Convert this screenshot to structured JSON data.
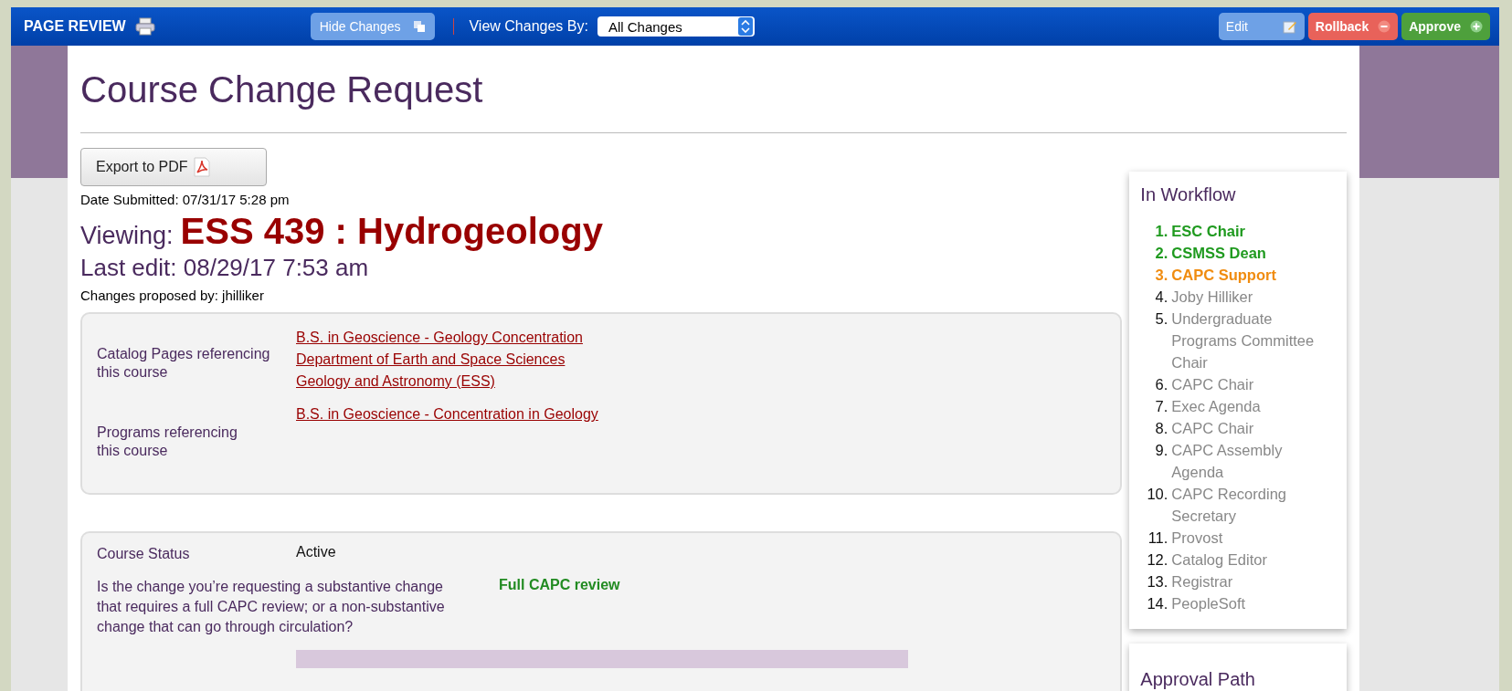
{
  "toolbar": {
    "title": "PAGE REVIEW",
    "hide_changes": "Hide Changes",
    "view_by_label": "View Changes By:",
    "view_by_value": "All Changes",
    "buttons": [
      {
        "label": "Edit",
        "kind": "edit"
      },
      {
        "label": "Rollback",
        "kind": "rollback"
      },
      {
        "label": "Approve",
        "kind": "approve"
      }
    ]
  },
  "page": {
    "title": "Course Change Request",
    "export": "Export to PDF",
    "date_submitted": "Date Submitted: 07/31/17 5:28 pm",
    "viewing_label": "Viewing:",
    "course": "ESS 439 : Hydrogeology",
    "last_edit": "Last edit: 08/29/17 7:53 am",
    "proposed_by": "Changes proposed by: jhilliker"
  },
  "references": [
    {
      "label": "Catalog Pages referencing this course",
      "links": [
        "B.S. in Geoscience - Geology Concentration",
        "Department of Earth and Space Sciences",
        "Geology and Astronomy (ESS)"
      ]
    },
    {
      "label": "Programs referencing this course",
      "links": [
        "B.S. in Geoscience - Concentration in Geology"
      ]
    }
  ],
  "fields": [
    {
      "label": "Course Status",
      "value": "Active",
      "kind": "plain"
    },
    {
      "label": "Is the change you’re requesting a substantive change that requires a full CAPC review; or a non-substantive change that can go through circulation?",
      "value": "Full CAPC review",
      "kind": "highlight"
    }
  ],
  "workflow": {
    "title": "In Workflow",
    "steps": [
      {
        "number": "1.",
        "name": "ESC Chair",
        "done": true,
        "current": false
      },
      {
        "number": "2.",
        "name": "CSMSS Dean",
        "done": true,
        "current": false
      },
      {
        "number": "3.",
        "name": "CAPC Support",
        "done": false,
        "current": true
      },
      {
        "number": "4.",
        "name": "Joby Hilliker",
        "done": false,
        "current": false
      },
      {
        "number": "5.",
        "name": "Undergraduate Programs Committee Chair",
        "done": false,
        "current": false
      },
      {
        "number": "6.",
        "name": "CAPC Chair",
        "done": false,
        "current": false
      },
      {
        "number": "7.",
        "name": "Exec Agenda",
        "done": false,
        "current": false
      },
      {
        "number": "8.",
        "name": "CAPC Chair",
        "done": false,
        "current": false
      },
      {
        "number": "9.",
        "name": "CAPC Assembly Agenda",
        "done": false,
        "current": false
      },
      {
        "number": "10.",
        "name": "CAPC Recording Secretary",
        "done": false,
        "current": false
      },
      {
        "number": "11.",
        "name": "Provost",
        "done": false,
        "current": false
      },
      {
        "number": "12.",
        "name": "Catalog Editor",
        "done": false,
        "current": false
      },
      {
        "number": "13.",
        "name": "Registrar",
        "done": false,
        "current": false
      },
      {
        "number": "14.",
        "name": "PeopleSoft",
        "done": false,
        "current": false
      }
    ]
  },
  "approval_path": {
    "title": "Approval Path"
  }
}
